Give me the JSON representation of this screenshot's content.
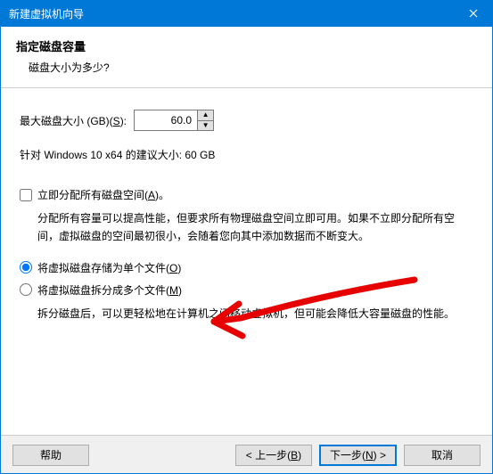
{
  "titlebar": {
    "title": "新建虚拟机向导"
  },
  "header": {
    "title": "指定磁盘容量",
    "subtitle": "磁盘大小为多少?"
  },
  "disk": {
    "label_prefix": "最大磁盘大小 (GB)(",
    "label_key": "S",
    "label_suffix": "):",
    "value": "60.0",
    "recommend": "针对 Windows 10 x64 的建议大小: 60 GB"
  },
  "allocate": {
    "label_prefix": "立即分配所有磁盘空间(",
    "label_key": "A",
    "label_suffix": ")。",
    "desc": "分配所有容量可以提高性能，但要求所有物理磁盘空间立即可用。如果不立即分配所有空间，虚拟磁盘的空间最初很小，会随着您向其中添加数据而不断变大。"
  },
  "radio": {
    "single_prefix": "将虚拟磁盘存储为单个文件(",
    "single_key": "O",
    "single_suffix": ")",
    "multi_prefix": "将虚拟磁盘拆分成多个文件(",
    "multi_key": "M",
    "multi_suffix": ")",
    "multi_desc": "拆分磁盘后，可以更轻松地在计算机之间移动虚拟机，但可能会降低大容量磁盘的性能。"
  },
  "buttons": {
    "help": "帮助",
    "back_prefix": "< 上一步(",
    "back_key": "B",
    "back_suffix": ")",
    "next_prefix": "下一步(",
    "next_key": "N",
    "next_suffix": ") >",
    "cancel": "取消"
  }
}
